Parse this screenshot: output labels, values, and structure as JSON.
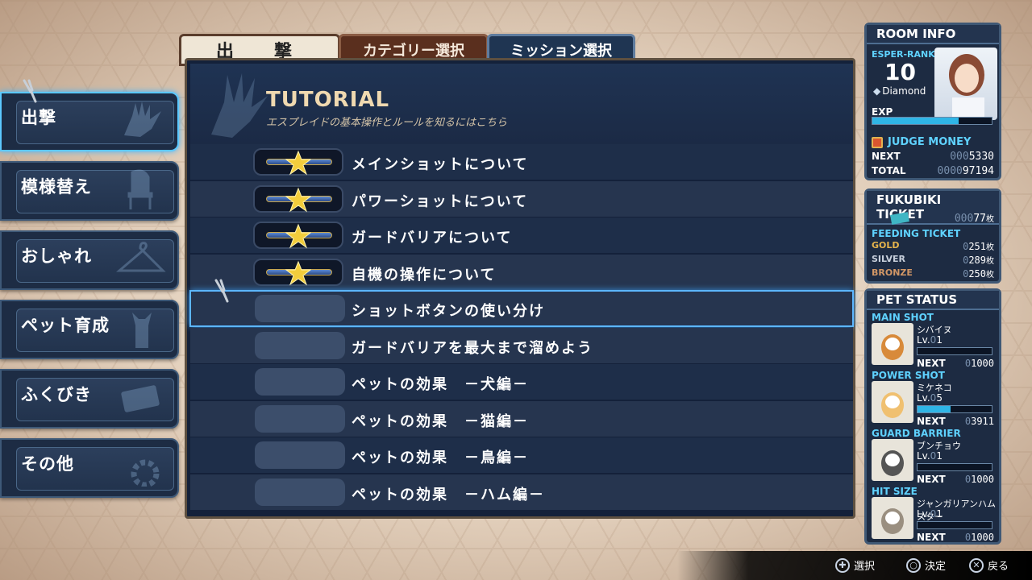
{
  "tabs": {
    "sortie": "出　撃",
    "category": "カテゴリー選択",
    "mission": "ミッション選択"
  },
  "left_menu": [
    {
      "label": "出撃",
      "icon": "hand-icon"
    },
    {
      "label": "模様替え",
      "icon": "chair-icon"
    },
    {
      "label": "おしゃれ",
      "icon": "hanger-icon"
    },
    {
      "label": "ペット育成",
      "icon": "cat-icon"
    },
    {
      "label": "ふくびき",
      "icon": "ticket-icon"
    },
    {
      "label": "その他",
      "icon": "gear-icon"
    }
  ],
  "tutorial": {
    "title": "TUTORIAL",
    "subtitle": "エスプレイドの基本操作とルールを知るにはこちら"
  },
  "missions": [
    {
      "label": "メインショットについて",
      "cleared": true
    },
    {
      "label": "パワーショットについて",
      "cleared": true
    },
    {
      "label": "ガードバリアについて",
      "cleared": true
    },
    {
      "label": "自機の操作について",
      "cleared": true
    },
    {
      "label": "ショットボタンの使い分け",
      "cleared": false
    },
    {
      "label": "ガードバリアを最大まで溜めよう",
      "cleared": false
    },
    {
      "label": "ペットの効果　－犬編－",
      "cleared": false
    },
    {
      "label": "ペットの効果　－猫編－",
      "cleared": false
    },
    {
      "label": "ペットの効果　－鳥編－",
      "cleared": false
    },
    {
      "label": "ペットの効果　－ハム編－",
      "cleared": false
    }
  ],
  "selected_index": 4,
  "room_info": {
    "title": "ROOM INFO",
    "rank_label": "ESPER-RANK",
    "rank": "10",
    "rank_tier": "Diamond",
    "exp_label": "EXP",
    "exp_progress": 0.72,
    "judge_money_label": "JUDGE MONEY",
    "next_label": "NEXT",
    "next_value_dim": "000",
    "next_value": "5330",
    "total_label": "TOTAL",
    "total_value_dim": "0000",
    "total_value": "97194"
  },
  "fukubiki": {
    "title": "FUKUBIKI TICKET",
    "count_dim": "000",
    "count": "77",
    "unit": "枚",
    "feeding_label": "FEEDING TICKET",
    "gold_label": "GOLD",
    "gold_dim": "0",
    "gold": "251",
    "silver_label": "SILVER",
    "silver_dim": "0",
    "silver": "289",
    "bronze_label": "BRONZE",
    "bronze_dim": "0",
    "bronze": "250"
  },
  "pet_status": {
    "title": "PET STATUS",
    "pets": [
      {
        "slot": "MAIN SHOT",
        "name": "シバイヌ",
        "lv_label": "Lv.",
        "lv_dim": "0",
        "lv": "1",
        "progress": 0.0,
        "next_label": "NEXT",
        "next_dim": "0",
        "next": "1000"
      },
      {
        "slot": "POWER SHOT",
        "name": "ミケネコ",
        "lv_label": "Lv.",
        "lv_dim": "0",
        "lv": "5",
        "progress": 0.45,
        "next_label": "NEXT",
        "next_dim": "0",
        "next": "3911"
      },
      {
        "slot": "GUARD BARRIER",
        "name": "ブンチョウ",
        "lv_label": "Lv.",
        "lv_dim": "0",
        "lv": "1",
        "progress": 0.0,
        "next_label": "NEXT",
        "next_dim": "0",
        "next": "1000"
      },
      {
        "slot": "HIT SIZE",
        "name": "ジャンガリアンハムスター",
        "lv_label": "Lv.",
        "lv_dim": "0",
        "lv": "1",
        "progress": 0.0,
        "next_label": "NEXT",
        "next_dim": "0",
        "next": "1000"
      }
    ]
  },
  "controls": {
    "select": "選択",
    "confirm": "決定",
    "back": "戻る"
  }
}
